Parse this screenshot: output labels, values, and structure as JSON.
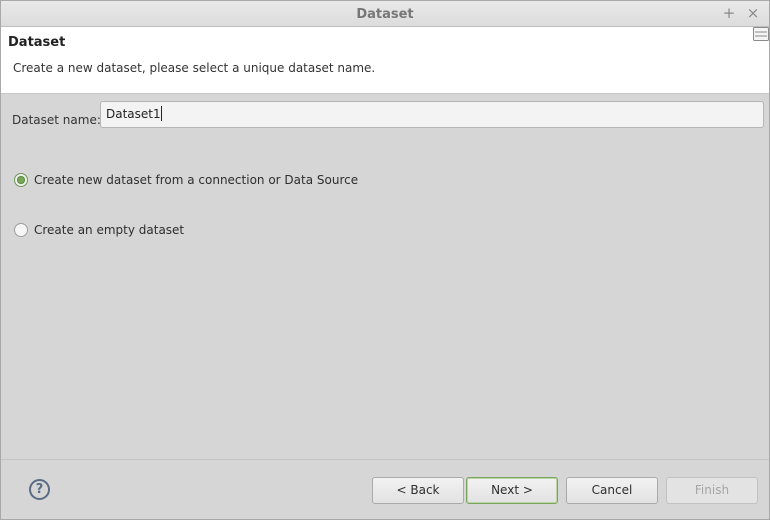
{
  "window": {
    "title": "Dataset",
    "maximize_symbol": "+",
    "close_symbol": "×"
  },
  "header": {
    "title": "Dataset",
    "description": "Create a new dataset, please select a unique dataset name.",
    "menu_icon": "view-menu-icon"
  },
  "form": {
    "name_label": "Dataset name:",
    "name_value": "Dataset1"
  },
  "options": [
    {
      "label": "Create new dataset from a connection or Data Source",
      "selected": true
    },
    {
      "label": "Create an empty dataset",
      "selected": false
    }
  ],
  "footer": {
    "help_symbol": "?",
    "back_label": "< Back",
    "next_label": "Next >",
    "cancel_label": "Cancel",
    "finish_label": "Finish"
  },
  "colors": {
    "accent_green": "#7aa65c",
    "help_blue": "#5a6c83"
  }
}
